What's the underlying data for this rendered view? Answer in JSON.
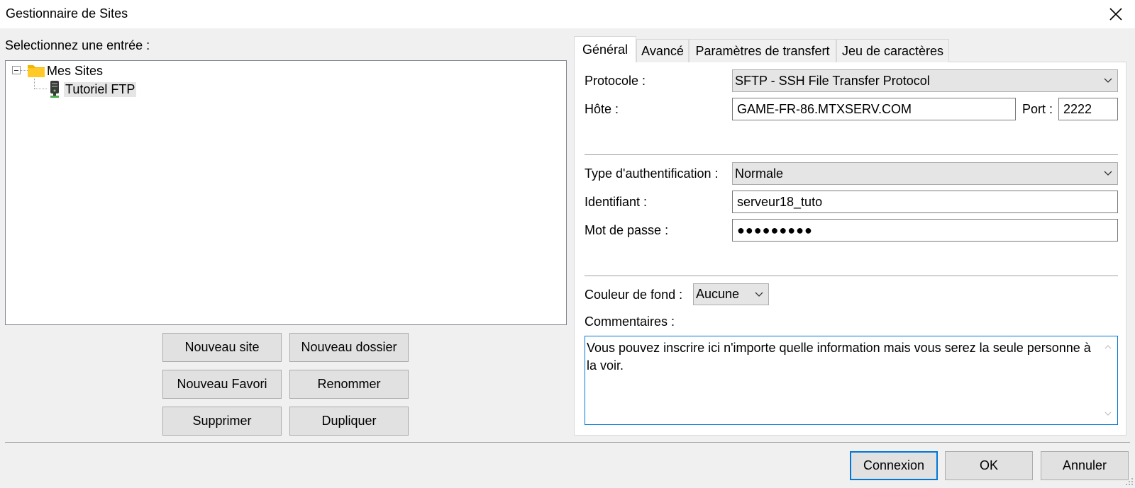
{
  "window": {
    "title": "Gestionnaire de Sites"
  },
  "left": {
    "select_label": "Selectionnez une entrée :",
    "tree": {
      "root": {
        "label": "Mes Sites",
        "icon": "folder-icon"
      },
      "child": {
        "label": "Tutoriel FTP",
        "icon": "server-icon"
      }
    },
    "buttons": {
      "new_site": "Nouveau site",
      "new_folder": "Nouveau dossier",
      "new_bookmark": "Nouveau Favori",
      "rename": "Renommer",
      "delete": "Supprimer",
      "duplicate": "Dupliquer"
    }
  },
  "tabs": [
    {
      "label": "Général",
      "active": true
    },
    {
      "label": "Avancé",
      "active": false
    },
    {
      "label": "Paramètres de transfert",
      "active": false
    },
    {
      "label": "Jeu de caractères",
      "active": false
    }
  ],
  "general": {
    "protocol_label": "Protocole :",
    "protocol_value": "SFTP - SSH File Transfer Protocol",
    "host_label": "Hôte :",
    "host_value": "GAME-FR-86.MTXSERV.COM",
    "port_label": "Port :",
    "port_value": "2222",
    "auth_label": "Type d'authentification :",
    "auth_value": "Normale",
    "user_label": "Identifiant :",
    "user_value": "serveur18_tuto",
    "password_label": "Mot de passe :",
    "password_value": "●●●●●●●●●",
    "bgcolor_label": "Couleur de fond :",
    "bgcolor_value": "Aucune",
    "comments_label": "Commentaires :",
    "comments_value": "Vous pouvez inscrire ici n'importe quelle information mais vous serez la seule personne à la voir."
  },
  "footer": {
    "connect": "Connexion",
    "ok": "OK",
    "cancel": "Annuler"
  },
  "colors": {
    "accent": "#0078d7",
    "folder": "#f4b400",
    "button_bg": "#e1e1e1"
  }
}
